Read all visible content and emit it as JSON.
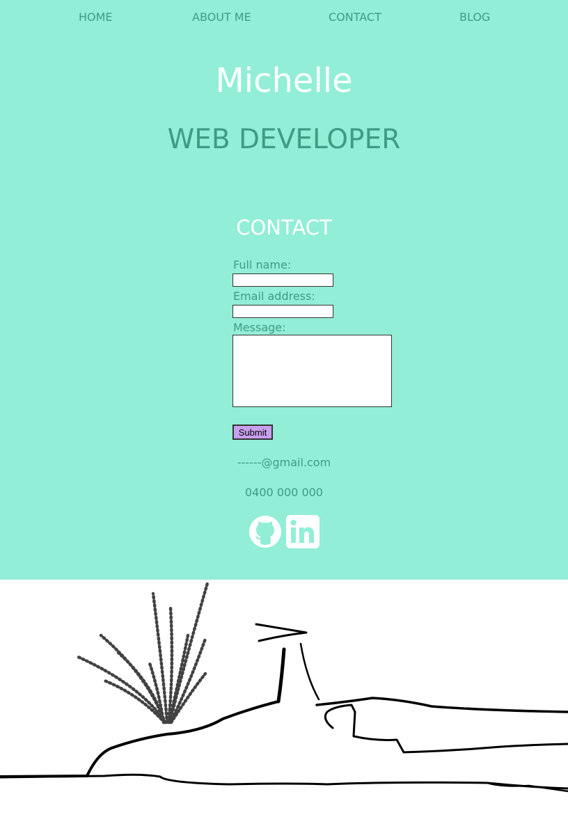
{
  "nav": {
    "items": [
      "HOME",
      "ABOUT ME",
      "CONTACT",
      "BLOG"
    ]
  },
  "hero": {
    "name": "Michelle",
    "role": "WEB DEVELOPER"
  },
  "contact": {
    "title": "CONTACT",
    "full_name_label": "Full name:",
    "email_label": "Email address:",
    "message_label": "Message:",
    "full_name_value": "",
    "email_value": "",
    "message_value": "",
    "submit_label": "Submit",
    "email": "------@gmail.com",
    "phone": "0400 000 000"
  },
  "social": {
    "icons": [
      "github-icon",
      "linkedin-icon"
    ]
  },
  "colors": {
    "background": "#92eed6",
    "accent_text": "#3f9b82",
    "heading": "#ffffff",
    "button": "#c9a0f0"
  }
}
